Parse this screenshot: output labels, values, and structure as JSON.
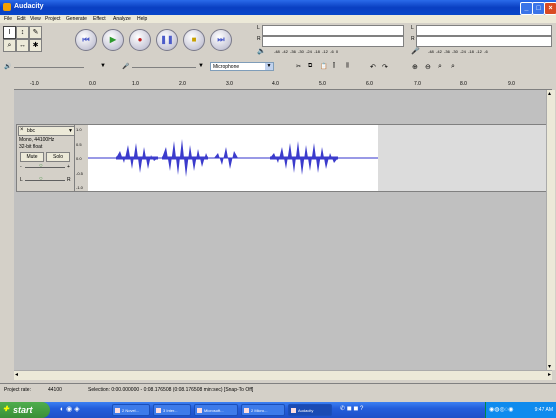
{
  "window": {
    "title": "Audacity"
  },
  "menu": [
    "File",
    "Edit",
    "View",
    "Project",
    "Generate",
    "Effect",
    "Analyze",
    "Help"
  ],
  "tools": [
    {
      "icon": "selection-tool-icon",
      "glyph": "I"
    },
    {
      "icon": "envelope-tool-icon",
      "glyph": "↕"
    },
    {
      "icon": "draw-tool-icon",
      "glyph": "✎"
    },
    {
      "icon": "zoom-tool-icon",
      "glyph": "⌕"
    },
    {
      "icon": "timeshift-tool-icon",
      "glyph": "↔"
    },
    {
      "icon": "multi-tool-icon",
      "glyph": "✱"
    }
  ],
  "transport": [
    {
      "name": "skip-start-button",
      "glyph": "⏮",
      "color": "#4b5bc9"
    },
    {
      "name": "play-button",
      "glyph": "▶",
      "color": "#2e9a2e"
    },
    {
      "name": "record-button",
      "glyph": "●",
      "color": "#c02020"
    },
    {
      "name": "pause-button",
      "glyph": "❚❚",
      "color": "#4b5bc9"
    },
    {
      "name": "stop-button",
      "glyph": "■",
      "color": "#c8a000"
    },
    {
      "name": "skip-end-button",
      "glyph": "⏭",
      "color": "#4b5bc9"
    }
  ],
  "meters": {
    "left_label": "L",
    "right_label": "R",
    "scale": [
      "-48",
      "-42",
      "-36",
      "-30",
      "-24",
      "-18",
      "-12",
      "-6",
      "0"
    ]
  },
  "mixer": {
    "input_device": "Microphone"
  },
  "ruler": [
    "-1.0",
    "0.0",
    "1.0",
    "2.0",
    "3.0",
    "4.0",
    "5.0",
    "6.0",
    "7.0",
    "8.0",
    "9.0"
  ],
  "track": {
    "name": "bbc",
    "info1": "Mono, 44100Hz",
    "info2": "32-bit float",
    "mute": "Mute",
    "solo": "Solo",
    "pan_left": "L",
    "pan_right": "R",
    "vscale": [
      "1.0",
      "0.5",
      "0.0",
      "-0.5",
      "-1.0"
    ]
  },
  "status": {
    "rate_label": "Project rate:",
    "rate_value": "44100",
    "selection": "Selection: 0:00.000000 - 0:08.176508 (0:08.176508 min:sec)  [Snap-To Off]"
  },
  "taskbar": {
    "start": "start",
    "items": [
      "2 Novel...",
      "3 Inter...",
      "Microsoft...",
      "2 Micro...",
      "Audacity"
    ],
    "clock": "9:47 AM"
  }
}
